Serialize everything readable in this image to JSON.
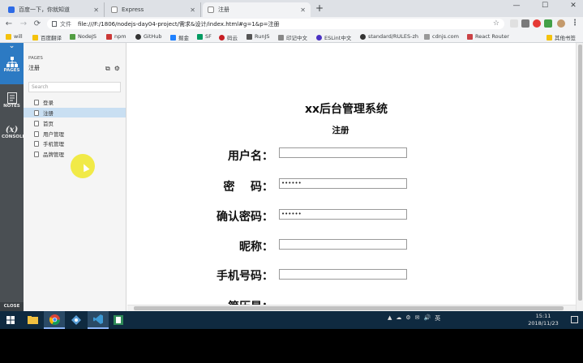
{
  "browser": {
    "tabs": [
      {
        "label": "百度一下，你就知道",
        "active": false
      },
      {
        "label": "Express",
        "active": false
      },
      {
        "label": "注册",
        "active": true
      }
    ],
    "new_tab": "+",
    "window_controls": {
      "minimize": "—",
      "maximize": "☐",
      "close": "✕"
    },
    "address": {
      "scheme_label": "文件",
      "url": "file:///F:/1806/nodejs-day04-project/需求&设计/index.html#g=1&p=注册"
    },
    "nav": {
      "back": "←",
      "forward": "→",
      "reload": "⟳"
    },
    "star": "☆",
    "bookmarks": [
      "will",
      "百度翻译",
      "NodeJS",
      "npm",
      "GitHub",
      "掘金",
      "SF",
      "码云",
      "RunJS",
      "印记中文",
      "ESLint中文",
      "standard/RULES-zh",
      "cdnjs.com",
      "React Router"
    ],
    "other_bookmarks": "其他书签"
  },
  "axure": {
    "left_tabs": [
      {
        "label": "PAGES",
        "icon": "sitemap-icon",
        "selected": true
      },
      {
        "label": "NOTES",
        "icon": "notes-icon",
        "selected": false
      },
      {
        "label": "CONSOLE",
        "icon": "function-icon",
        "selected": false
      }
    ],
    "console_glyph": "(x)",
    "close_label": "CLOSE",
    "pages_panel": {
      "heading": "PAGES",
      "title": "注册",
      "search_placeholder": "Search",
      "items": [
        {
          "label": "登录",
          "selected": false
        },
        {
          "label": "注册",
          "selected": true
        },
        {
          "label": "首页",
          "selected": false
        },
        {
          "label": "用户管理",
          "selected": false
        },
        {
          "label": "手机管理",
          "selected": false
        },
        {
          "label": "品牌管理",
          "selected": false
        }
      ]
    }
  },
  "form": {
    "system_title": "xx后台管理系统",
    "subtitle": "注册",
    "fields": [
      {
        "label": "用户名：",
        "value": ""
      },
      {
        "label": "密    码：",
        "value": "••••••"
      },
      {
        "label": "确认密码：",
        "value": "••••••"
      },
      {
        "label": "昵称：",
        "value": ""
      },
      {
        "label": "手机号码：",
        "value": ""
      },
      {
        "label": "简历是：",
        "value": ""
      }
    ]
  },
  "taskbar": {
    "apps": [
      "start",
      "file-explorer",
      "chrome",
      "sourcetree",
      "vscode",
      "app-5"
    ],
    "tray": [
      "▲",
      "☁",
      "⚙",
      "✉",
      "🔊",
      "英"
    ],
    "time": "15:11",
    "date": "2018/11/23"
  },
  "colors": {
    "tab_bar": "#dee1e6",
    "axure_sidebar": "#4a4f53",
    "axure_selected": "#2c7ac3",
    "page_selected": "#c9dff2",
    "taskbar": "#0f2a40"
  }
}
